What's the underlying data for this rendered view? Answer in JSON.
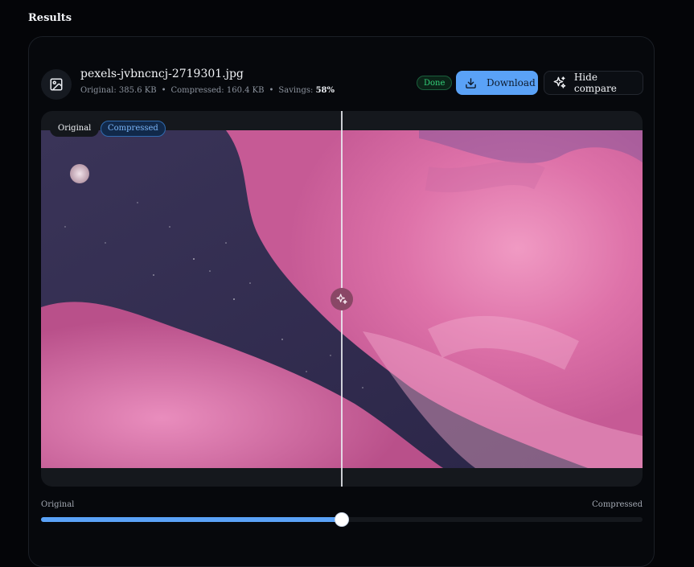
{
  "heading": "Results",
  "file": {
    "name": "pexels-jvbncncj-2719301.jpg",
    "original_label": "Original: 385.6 KB",
    "compressed_label": "Compressed: 160.4 KB",
    "savings_label": "Savings:",
    "savings_value": "58%",
    "separator": "•",
    "icon": "image-icon"
  },
  "status": {
    "label": "Done",
    "color": "#34d27b"
  },
  "actions": {
    "download_label": "Download",
    "download_icon": "download-icon",
    "compare_label": "Hide compare",
    "compare_icon": "sparkles-icon"
  },
  "compare": {
    "left_label": "Original",
    "right_label": "Compressed",
    "handle_icon": "sparkles-icon"
  },
  "slider": {
    "left_label": "Original",
    "right_label": "Compressed",
    "value_percent": 50
  },
  "colors": {
    "accent": "#5aa2f7",
    "background": "#040508",
    "done_green": "#34d27b"
  }
}
